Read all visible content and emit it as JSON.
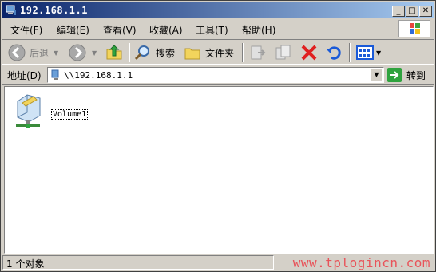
{
  "window": {
    "title": "192.168.1.1",
    "min_label": "_",
    "max_label": "□",
    "close_label": "✕"
  },
  "menu": {
    "items": [
      {
        "label": "文件(F)"
      },
      {
        "label": "编辑(E)"
      },
      {
        "label": "查看(V)"
      },
      {
        "label": "收藏(A)"
      },
      {
        "label": "工具(T)"
      },
      {
        "label": "帮助(H)"
      }
    ]
  },
  "toolbar": {
    "back_label": "后退",
    "search_label": "搜索",
    "folders_label": "文件夹"
  },
  "address": {
    "label": "地址(D)",
    "value": "\\\\192.168.1.1",
    "go_label": "转到"
  },
  "content": {
    "items": [
      {
        "label": "Volume1",
        "icon": "shared-drive-icon"
      }
    ]
  },
  "status": {
    "text": "1 个对象",
    "watermark": "www.tplogincn.com"
  },
  "colors": {
    "title_start": "#0a246a",
    "title_end": "#a6caf0",
    "chrome": "#d4d0c8",
    "watermark": "#e8545a"
  }
}
